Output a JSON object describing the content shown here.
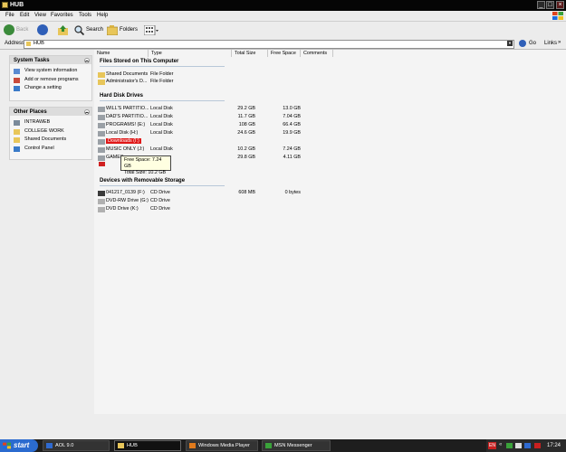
{
  "window": {
    "title": "HUB"
  },
  "menu": [
    "File",
    "Edit",
    "View",
    "Favorites",
    "Tools",
    "Help"
  ],
  "toolbar": {
    "back_label": "Back",
    "search_label": "Search",
    "folders_label": "Folders"
  },
  "address": {
    "label": "Address",
    "value": "HUB",
    "go_label": "Go",
    "links_label": "Links"
  },
  "left_pane": {
    "system_tasks": {
      "title": "System Tasks",
      "items": [
        "View system information",
        "Add or remove programs",
        "Change a setting"
      ]
    },
    "other_places": {
      "title": "Other Places",
      "items": [
        "INTRAWEB",
        "COLLEGE WORK",
        "Shared Documents",
        "Control Panel"
      ]
    }
  },
  "columns": [
    "Name",
    "Type",
    "Total Size",
    "Free Space",
    "Comments"
  ],
  "groups": {
    "files": {
      "title": "Files Stored on This Computer",
      "items": [
        {
          "name": "Shared Documents",
          "type": "File Folder"
        },
        {
          "name": "Administrator's D...",
          "type": "File Folder"
        }
      ]
    },
    "hdd": {
      "title": "Hard Disk Drives",
      "items": [
        {
          "name": "WILL'S PARTITIO...",
          "type": "Local Disk",
          "total": "29.2 GB",
          "free": "13.0 GB"
        },
        {
          "name": "DAD'S PARTITIO...",
          "type": "Local Disk",
          "total": "11.7 GB",
          "free": "7.04 GB"
        },
        {
          "name": "PROGRAMS! (E:)",
          "type": "Local Disk",
          "total": "108 GB",
          "free": "66.4 GB"
        },
        {
          "name": "Local Disk (H:)",
          "type": "Local Disk",
          "total": "24.6 GB",
          "free": "19.9 GB"
        },
        {
          "name": "Downloads (I:)",
          "type": "",
          "total": "",
          "free": ""
        },
        {
          "name": "MUSIC ONLY (J:)",
          "type": "Local Disk",
          "total": "10.2 GB",
          "free": "7.24 GB"
        },
        {
          "name": "GAMES",
          "type": "",
          "total": "29.8 GB",
          "free": "4.11 GB"
        }
      ]
    },
    "removable": {
      "title": "Devices with Removable Storage",
      "items": [
        {
          "name": "041217_0139 (F:)",
          "type": "CD Drive",
          "total": "608 MB",
          "free": "0 bytes"
        },
        {
          "name": "DVD-RW Drive (G:)",
          "type": "CD Drive",
          "total": "",
          "free": ""
        },
        {
          "name": "DVD Drive (K:)",
          "type": "CD Drive",
          "total": "",
          "free": ""
        }
      ]
    }
  },
  "tooltip": {
    "line1": "Free Space: 7.24 GB",
    "line2": "Total Size: 10.2 GB"
  },
  "taskbar": {
    "start_label": "start",
    "buttons": [
      "AOL 9.0",
      "HUB",
      "Windows Media Player",
      "MSN Messenger"
    ],
    "language": "EN",
    "clock": "17:24"
  },
  "colors": {
    "selection": "#e01818",
    "start_button": "#2b6bcf",
    "title_bar": "#050505"
  }
}
